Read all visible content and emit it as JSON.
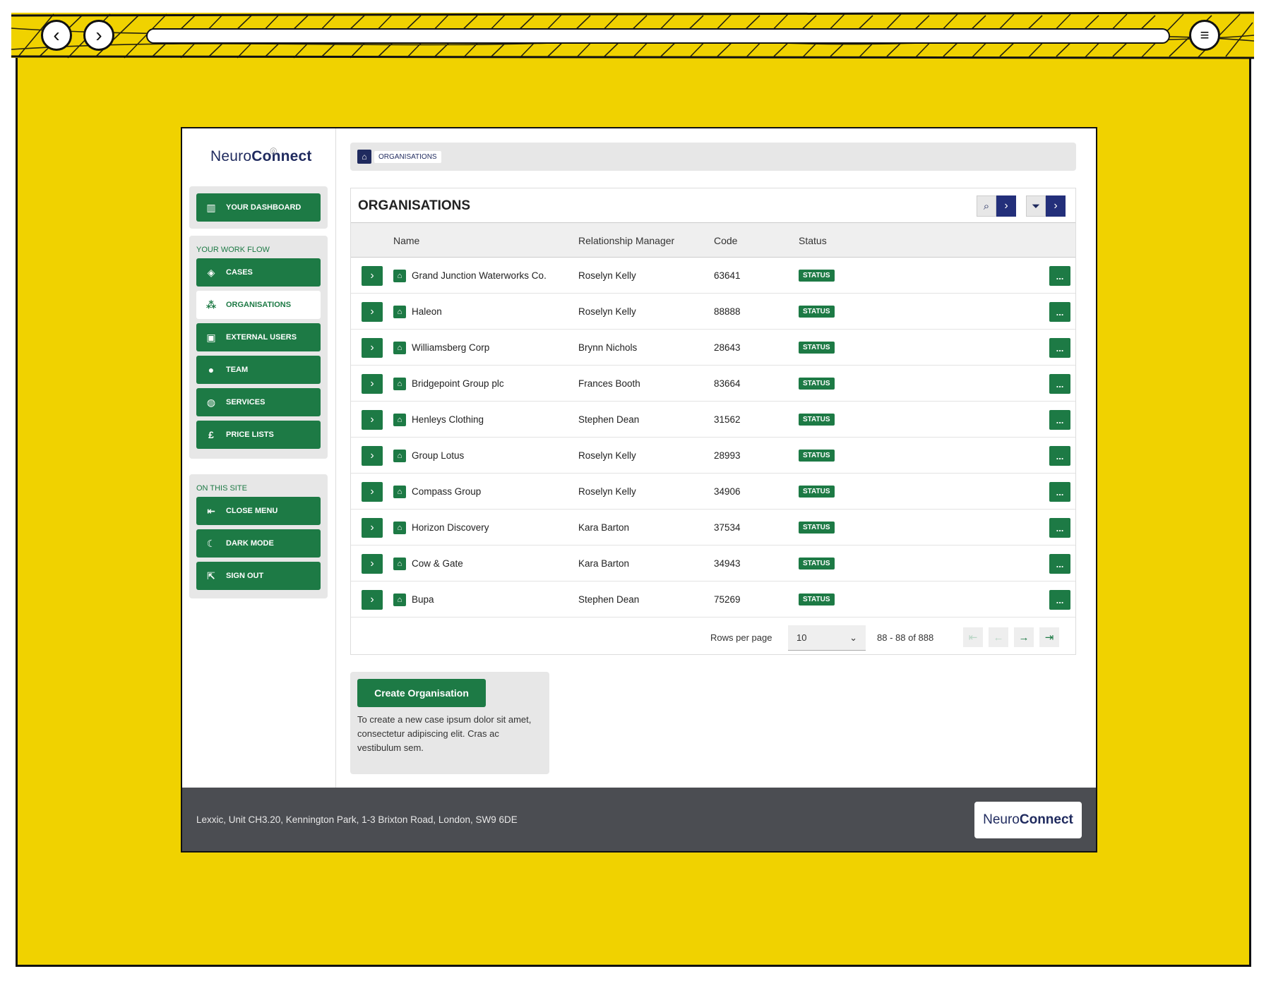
{
  "app": {
    "logo_prefix": "Neuro",
    "logo_suffix": "Connect"
  },
  "sidebar": {
    "dashboard_label": "YOUR DASHBOARD",
    "workflow_title": "YOUR WORK FLOW",
    "workflow_items": [
      {
        "label": "CASES",
        "icon": "layers-icon"
      },
      {
        "label": "ORGANISATIONS",
        "icon": "org-chart-icon",
        "active": true
      },
      {
        "label": "EXTERNAL USERS",
        "icon": "user-badge-icon"
      },
      {
        "label": "TEAM",
        "icon": "person-icon"
      },
      {
        "label": "SERVICES",
        "icon": "services-icon"
      },
      {
        "label": "PRICE LISTS",
        "icon": "pound-icon"
      }
    ],
    "site_title": "ON THIS SITE",
    "site_items": [
      {
        "label": "CLOSE MENU",
        "icon": "close-menu-icon"
      },
      {
        "label": "DARK MODE",
        "icon": "moon-icon"
      },
      {
        "label": "SIGN OUT",
        "icon": "sign-out-icon"
      }
    ]
  },
  "breadcrumb": {
    "current": "ORGANISATIONS"
  },
  "panel": {
    "title": "ORGANISATIONS",
    "columns": [
      "Name",
      "Relationship Manager",
      "Code",
      "Status"
    ],
    "rows": [
      {
        "name": "Grand Junction Waterworks Co.",
        "manager": "Roselyn Kelly",
        "code": "63641",
        "status": "STATUS"
      },
      {
        "name": "Haleon",
        "manager": "Roselyn Kelly",
        "code": "88888",
        "status": "STATUS"
      },
      {
        "name": "Williamsberg Corp",
        "manager": "Brynn Nichols",
        "code": "28643",
        "status": "STATUS"
      },
      {
        "name": "Bridgepoint Group plc",
        "manager": "Frances Booth",
        "code": "83664",
        "status": "STATUS"
      },
      {
        "name": "Henleys Clothing",
        "manager": "Stephen Dean",
        "code": "31562",
        "status": "STATUS"
      },
      {
        "name": "Group Lotus",
        "manager": "Roselyn Kelly",
        "code": "28993",
        "status": "STATUS"
      },
      {
        "name": "Compass Group",
        "manager": "Roselyn Kelly",
        "code": "34906",
        "status": "STATUS"
      },
      {
        "name": "Horizon Discovery",
        "manager": "Kara Barton",
        "code": "37534",
        "status": "STATUS"
      },
      {
        "name": "Cow & Gate",
        "manager": "Kara Barton",
        "code": "34943",
        "status": "STATUS"
      },
      {
        "name": "Bupa",
        "manager": "Stephen Dean",
        "code": "75269",
        "status": "STATUS"
      }
    ],
    "more_label": "...",
    "pager": {
      "rows_per_page_label": "Rows per page",
      "rows_per_page_value": "10",
      "range": "88 - 88 of 888"
    }
  },
  "create": {
    "button_label": "Create Organisation",
    "description": "To create a new case ipsum dolor sit amet, consectetur adipiscing elit. Cras ac vestibulum sem."
  },
  "footer": {
    "address": "Lexxic, Unit CH3.20, Kennington Park, 1-3 Brixton Road, London, SW9 6DE"
  },
  "colors": {
    "brand_green": "#1d7a45",
    "brand_navy": "#232f7a",
    "frame_yellow": "#f0d200",
    "footer_grey": "#4b4d52"
  }
}
